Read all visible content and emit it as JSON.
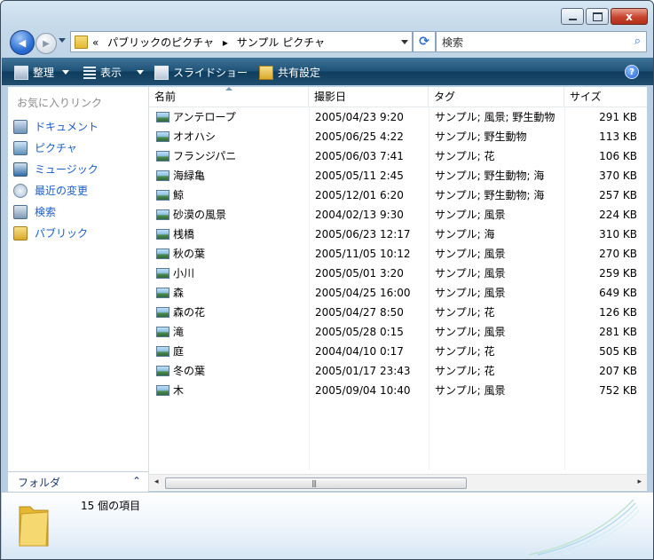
{
  "window": {
    "minimize": "─",
    "maximize": "□",
    "close": "x"
  },
  "nav": {
    "back_glyph": "◀",
    "forward_glyph": "▶",
    "breadcrumb_prefix": "«",
    "crumb1": "パブリックのピクチャ",
    "separator": "▸",
    "crumb2": "サンプル ピクチャ",
    "search_placeholder": "検索",
    "refresh_glyph": "⟳",
    "search_glyph": "⌕"
  },
  "toolbar": {
    "organize": "整理",
    "view": "表示",
    "slideshow": "スライドショー",
    "share": "共有設定",
    "help": "?"
  },
  "sidebar": {
    "heading": "お気に入りリンク",
    "items": [
      {
        "label": "ドキュメント",
        "icon": "documents-icon"
      },
      {
        "label": "ピクチャ",
        "icon": "pictures-icon"
      },
      {
        "label": "ミュージック",
        "icon": "music-icon"
      },
      {
        "label": "最近の変更",
        "icon": "recent-changes-icon"
      },
      {
        "label": "検索",
        "icon": "search-folder-icon"
      },
      {
        "label": "パブリック",
        "icon": "public-folder-icon"
      }
    ],
    "folders_label": "フォルダ",
    "folders_chevron": "⌃"
  },
  "columns": {
    "name": "名前",
    "date": "撮影日",
    "tags": "タグ",
    "size": "サイズ"
  },
  "files": [
    {
      "name": "アンテロープ",
      "date": "2005/04/23 9:20",
      "tags": "サンプル; 風景; 野生動物",
      "size": "291 KB"
    },
    {
      "name": "オオハシ",
      "date": "2005/06/25 4:22",
      "tags": "サンプル; 野生動物",
      "size": "113 KB"
    },
    {
      "name": "フランジパニ",
      "date": "2005/06/03 7:41",
      "tags": "サンプル; 花",
      "size": "106 KB"
    },
    {
      "name": "海緑亀",
      "date": "2005/05/11 2:45",
      "tags": "サンプル; 野生動物; 海",
      "size": "370 KB"
    },
    {
      "name": "鯨",
      "date": "2005/12/01 6:20",
      "tags": "サンプル; 野生動物; 海",
      "size": "257 KB"
    },
    {
      "name": "砂漠の風景",
      "date": "2004/02/13 9:30",
      "tags": "サンプル; 風景",
      "size": "224 KB"
    },
    {
      "name": "桟橋",
      "date": "2005/06/23 12:17",
      "tags": "サンプル; 海",
      "size": "310 KB"
    },
    {
      "name": "秋の葉",
      "date": "2005/11/05 10:12",
      "tags": "サンプル; 風景",
      "size": "270 KB"
    },
    {
      "name": "小川",
      "date": "2005/05/01 3:20",
      "tags": "サンプル; 風景",
      "size": "259 KB"
    },
    {
      "name": "森",
      "date": "2005/04/25 16:00",
      "tags": "サンプル; 風景",
      "size": "649 KB"
    },
    {
      "name": "森の花",
      "date": "2005/04/27 8:50",
      "tags": "サンプル; 花",
      "size": "126 KB"
    },
    {
      "name": "滝",
      "date": "2005/05/28 0:15",
      "tags": "サンプル; 風景",
      "size": "281 KB"
    },
    {
      "name": "庭",
      "date": "2004/04/10 0:17",
      "tags": "サンプル; 花",
      "size": "505 KB"
    },
    {
      "name": "冬の葉",
      "date": "2005/01/17 23:43",
      "tags": "サンプル; 花",
      "size": "207 KB"
    },
    {
      "name": "木",
      "date": "2005/09/04 10:40",
      "tags": "サンプル; 風景",
      "size": "752 KB"
    }
  ],
  "scroll": {
    "left": "◂",
    "right": "▸",
    "grip": "|||"
  },
  "details": {
    "item_count": "15 個の項目"
  },
  "colors": {
    "link": "#1a5ec8",
    "toolbar": "#1f5378",
    "window_frame": "#c5d9ea"
  }
}
